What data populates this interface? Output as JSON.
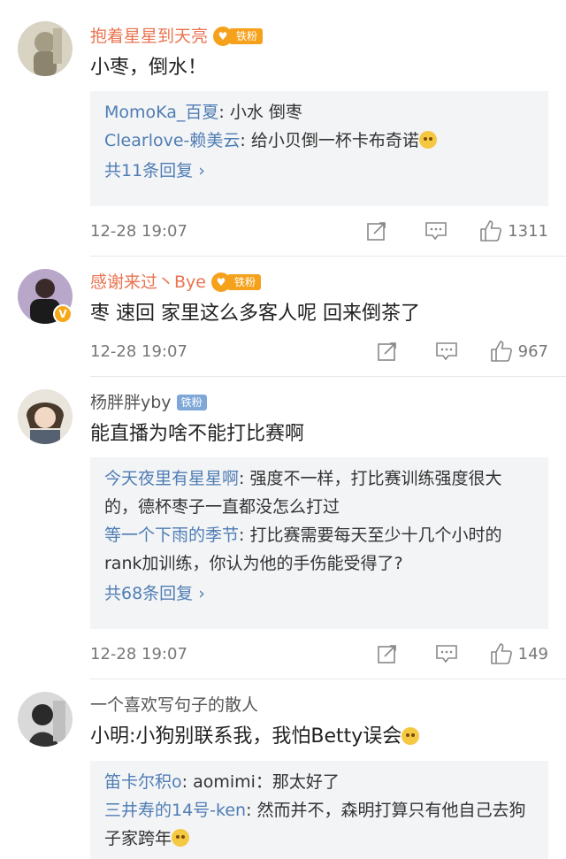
{
  "comments": [
    {
      "username": "抱着星星到天亮",
      "badge": "铁粉",
      "text": "小枣，倒水！",
      "replies": [
        {
          "user": "MomoKa_百夏",
          "text": "小水 倒枣"
        },
        {
          "user": "Clearlove-赖美云",
          "text": "给小贝倒一杯卡布奇诺"
        }
      ],
      "more": "共11条回复 ›",
      "time": "12-28 19:07",
      "likes": "1311"
    },
    {
      "username": "感谢来过丶Bye",
      "badge": "铁粉",
      "text": "枣 速回 家里这么多客人呢 回来倒茶了",
      "time": "12-28 19:07",
      "likes": "967"
    },
    {
      "username": "杨胖胖yby",
      "badge": "铁粉",
      "text": "能直播为啥不能打比赛啊",
      "replies": [
        {
          "user": "今天夜里有星星啊",
          "text": "强度不一样，打比赛训练强度很大的，德杯枣子一直都没怎么打过"
        },
        {
          "user": "等一个下雨的季节",
          "text": "打比赛需要每天至少十几个小时的rank加训练，你认为他的手伤能受得了?"
        }
      ],
      "more": "共68条回复 ›",
      "time": "12-28 19:07",
      "likes": "149"
    },
    {
      "username": "一个喜欢写句子的散人",
      "text": "小明:小狗别联系我，我怕Betty误会",
      "replies": [
        {
          "user": "笛卡尔积o",
          "text": "aomimi：那太好了"
        },
        {
          "user": "三井寿的14号-ken",
          "text": "然而并不，森明打算只有他自己去狗子家跨年"
        }
      ]
    }
  ],
  "colors": {
    "vip_name": "#eb7350",
    "reply_user": "#4f7db4",
    "badge": "#f6a11c",
    "badge_plain": "#7fa8d8"
  }
}
